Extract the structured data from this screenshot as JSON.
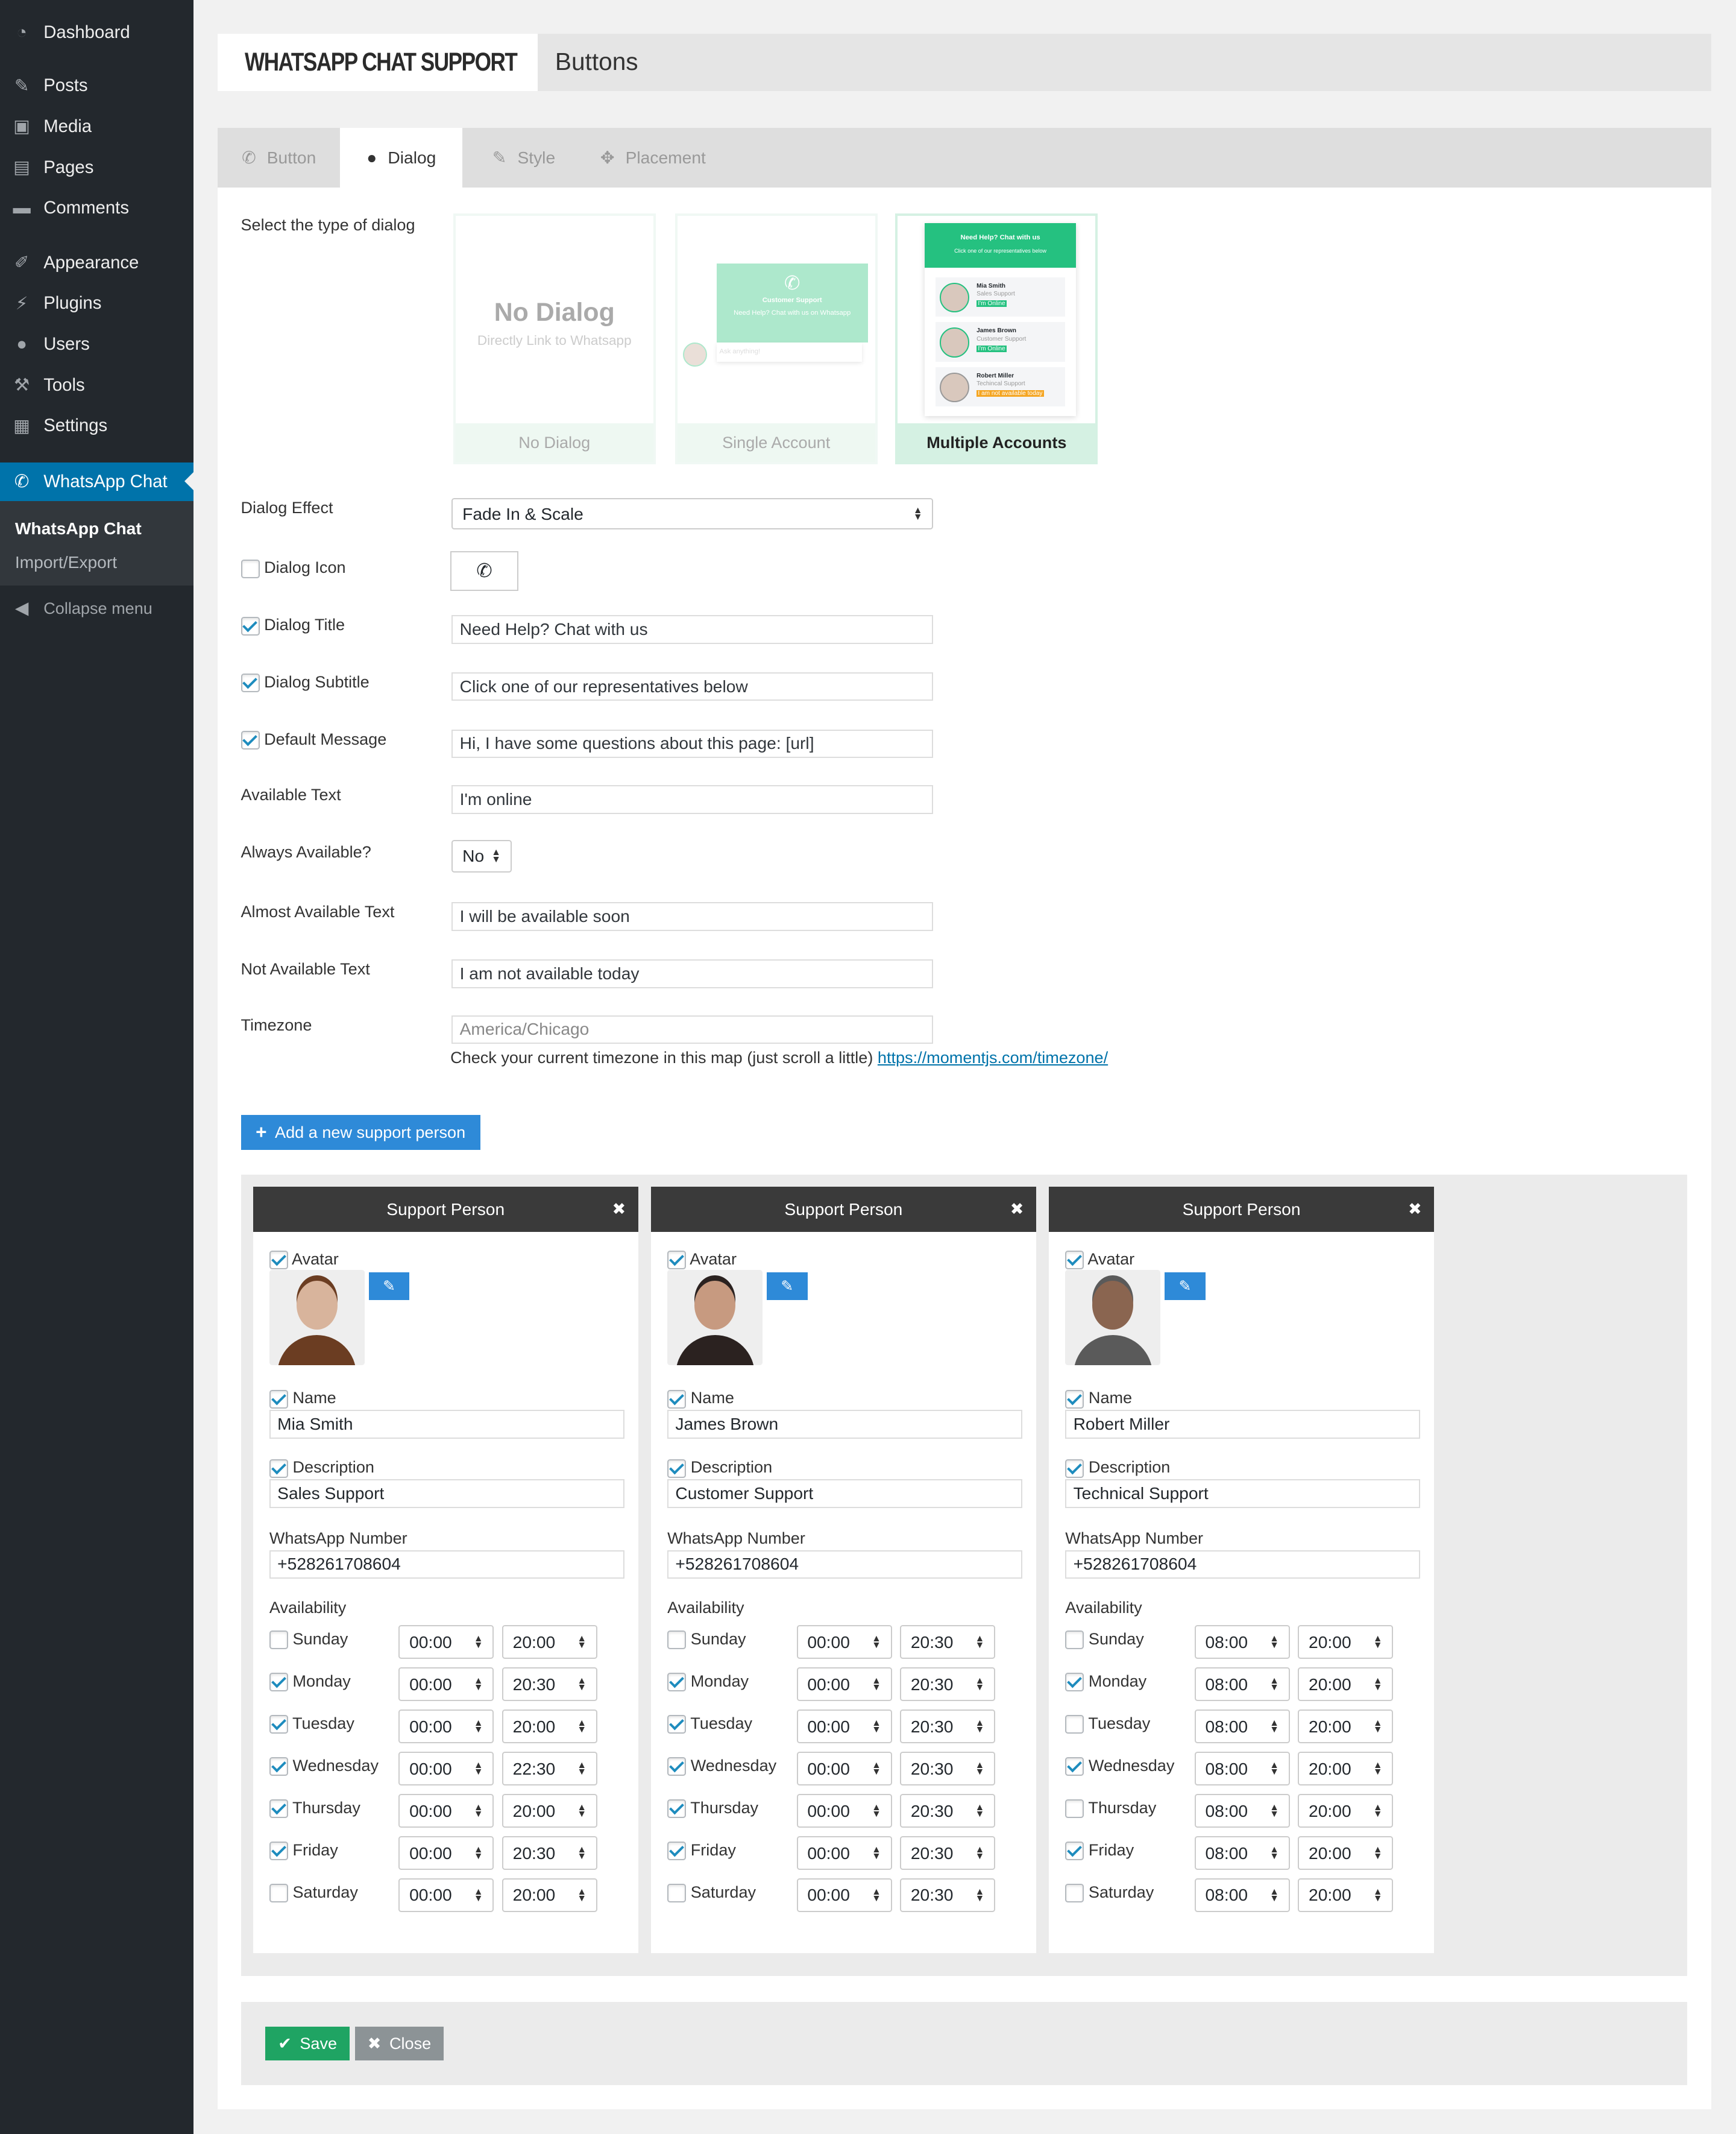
{
  "sidebar": {
    "items": [
      {
        "label": "Dashboard",
        "icon": "dashboard-icon"
      },
      {
        "label": "Posts",
        "icon": "pin-icon"
      },
      {
        "label": "Media",
        "icon": "media-icon"
      },
      {
        "label": "Pages",
        "icon": "pages-icon"
      },
      {
        "label": "Comments",
        "icon": "comment-icon"
      },
      {
        "label": "Appearance",
        "icon": "brush-icon"
      },
      {
        "label": "Plugins",
        "icon": "plugin-icon"
      },
      {
        "label": "Users",
        "icon": "user-icon"
      },
      {
        "label": "Tools",
        "icon": "wrench-icon"
      },
      {
        "label": "Settings",
        "icon": "settings-icon"
      },
      {
        "label": "WhatsApp Chat",
        "icon": "whatsapp-icon"
      }
    ],
    "submenu": [
      "WhatsApp Chat",
      "Import/Export"
    ],
    "collapse": "Collapse menu"
  },
  "header": {
    "logo_text": "WHATSAPP CHAT SUPPORT",
    "title": "Buttons"
  },
  "tabs": [
    {
      "label": "Button"
    },
    {
      "label": "Dialog",
      "active": true
    },
    {
      "label": "Style"
    },
    {
      "label": "Placement"
    }
  ],
  "dialog_type": {
    "label": "Select the type of dialog",
    "options": [
      {
        "label": "No Dialog",
        "preview_title": "No Dialog",
        "preview_sub": "Directly Link to Whatsapp"
      },
      {
        "label": "Single Account",
        "preview_title": "Customer Support",
        "preview_sub": "Need Help? Chat with us on Whatsapp",
        "preview_input": "Ask anything!"
      },
      {
        "label": "Multiple Accounts",
        "selected": true,
        "preview_title": "Need Help? Chat with us",
        "preview_sub": "Click one of our representatives below",
        "people": [
          {
            "name": "Mia Smith",
            "desc": "Sales Support",
            "status": "I'm Online"
          },
          {
            "name": "James Brown",
            "desc": "Customer Support",
            "status": "I'm Online"
          },
          {
            "name": "Robert Miller",
            "desc": "Techincal Support",
            "status": "I am not available today"
          }
        ]
      }
    ]
  },
  "form": {
    "effect_label": "Dialog Effect",
    "effect_value": "Fade In & Scale",
    "icon_label": "Dialog Icon",
    "title_label": "Dialog Title",
    "title_value": "Need Help? Chat with us",
    "subtitle_label": "Dialog Subtitle",
    "subtitle_value": "Click one of our representatives below",
    "message_label": "Default Message",
    "message_value": "Hi, I have some questions about this page: [url]",
    "available_label": "Available Text",
    "available_value": "I'm online",
    "always_label": "Always Available?",
    "always_value": "No",
    "almost_label": "Almost Available Text",
    "almost_value": "I will be available soon",
    "notavail_label": "Not Available Text",
    "notavail_value": "I am not available today",
    "tz_label": "Timezone",
    "tz_placeholder": "America/Chicago",
    "tz_help": "Check your current timezone in this map (just scroll a little) ",
    "tz_link": "https://momentjs.com/timezone/"
  },
  "add_button": "Add a new support person",
  "persons": [
    {
      "header": "Support Person",
      "avatar_label": "Avatar",
      "name_label": "Name",
      "name": "Mia Smith",
      "desc_label": "Description",
      "desc": "Sales Support",
      "phone_label": "WhatsApp Number",
      "phone": "+528261708604",
      "avail_label": "Availability",
      "days": [
        {
          "day": "Sunday",
          "on": false,
          "from": "00:00",
          "to": "20:00"
        },
        {
          "day": "Monday",
          "on": true,
          "from": "00:00",
          "to": "20:30"
        },
        {
          "day": "Tuesday",
          "on": true,
          "from": "00:00",
          "to": "20:00"
        },
        {
          "day": "Wednesday",
          "on": true,
          "from": "00:00",
          "to": "22:30"
        },
        {
          "day": "Thursday",
          "on": true,
          "from": "00:00",
          "to": "20:00"
        },
        {
          "day": "Friday",
          "on": true,
          "from": "00:00",
          "to": "20:30"
        },
        {
          "day": "Saturday",
          "on": false,
          "from": "00:00",
          "to": "20:00"
        }
      ]
    },
    {
      "header": "Support Person",
      "avatar_label": "Avatar",
      "name_label": "Name",
      "name": "James Brown",
      "desc_label": "Description",
      "desc": "Customer Support",
      "phone_label": "WhatsApp Number",
      "phone": "+528261708604",
      "avail_label": "Availability",
      "days": [
        {
          "day": "Sunday",
          "on": false,
          "from": "00:00",
          "to": "20:30"
        },
        {
          "day": "Monday",
          "on": true,
          "from": "00:00",
          "to": "20:30"
        },
        {
          "day": "Tuesday",
          "on": true,
          "from": "00:00",
          "to": "20:30"
        },
        {
          "day": "Wednesday",
          "on": true,
          "from": "00:00",
          "to": "20:30"
        },
        {
          "day": "Thursday",
          "on": true,
          "from": "00:00",
          "to": "20:30"
        },
        {
          "day": "Friday",
          "on": true,
          "from": "00:00",
          "to": "20:30"
        },
        {
          "day": "Saturday",
          "on": false,
          "from": "00:00",
          "to": "20:30"
        }
      ]
    },
    {
      "header": "Support Person",
      "avatar_label": "Avatar",
      "name_label": "Name",
      "name": "Robert Miller",
      "desc_label": "Description",
      "desc": "Technical Support",
      "phone_label": "WhatsApp Number",
      "phone": "+528261708604",
      "avail_label": "Availability",
      "days": [
        {
          "day": "Sunday",
          "on": false,
          "from": "08:00",
          "to": "20:00"
        },
        {
          "day": "Monday",
          "on": true,
          "from": "08:00",
          "to": "20:00"
        },
        {
          "day": "Tuesday",
          "on": false,
          "from": "08:00",
          "to": "20:00"
        },
        {
          "day": "Wednesday",
          "on": true,
          "from": "08:00",
          "to": "20:00"
        },
        {
          "day": "Thursday",
          "on": false,
          "from": "08:00",
          "to": "20:00"
        },
        {
          "day": "Friday",
          "on": true,
          "from": "08:00",
          "to": "20:00"
        },
        {
          "day": "Saturday",
          "on": false,
          "from": "08:00",
          "to": "20:00"
        }
      ]
    }
  ],
  "footer": {
    "save": "Save",
    "close": "Close"
  },
  "colors": {
    "sidebar": "#23282d",
    "accent": "#0073aa",
    "whatsapp_green": "#25c180",
    "button_blue": "#2e8ad8",
    "save_green": "#1fa463",
    "close_grey": "#8c9396"
  }
}
